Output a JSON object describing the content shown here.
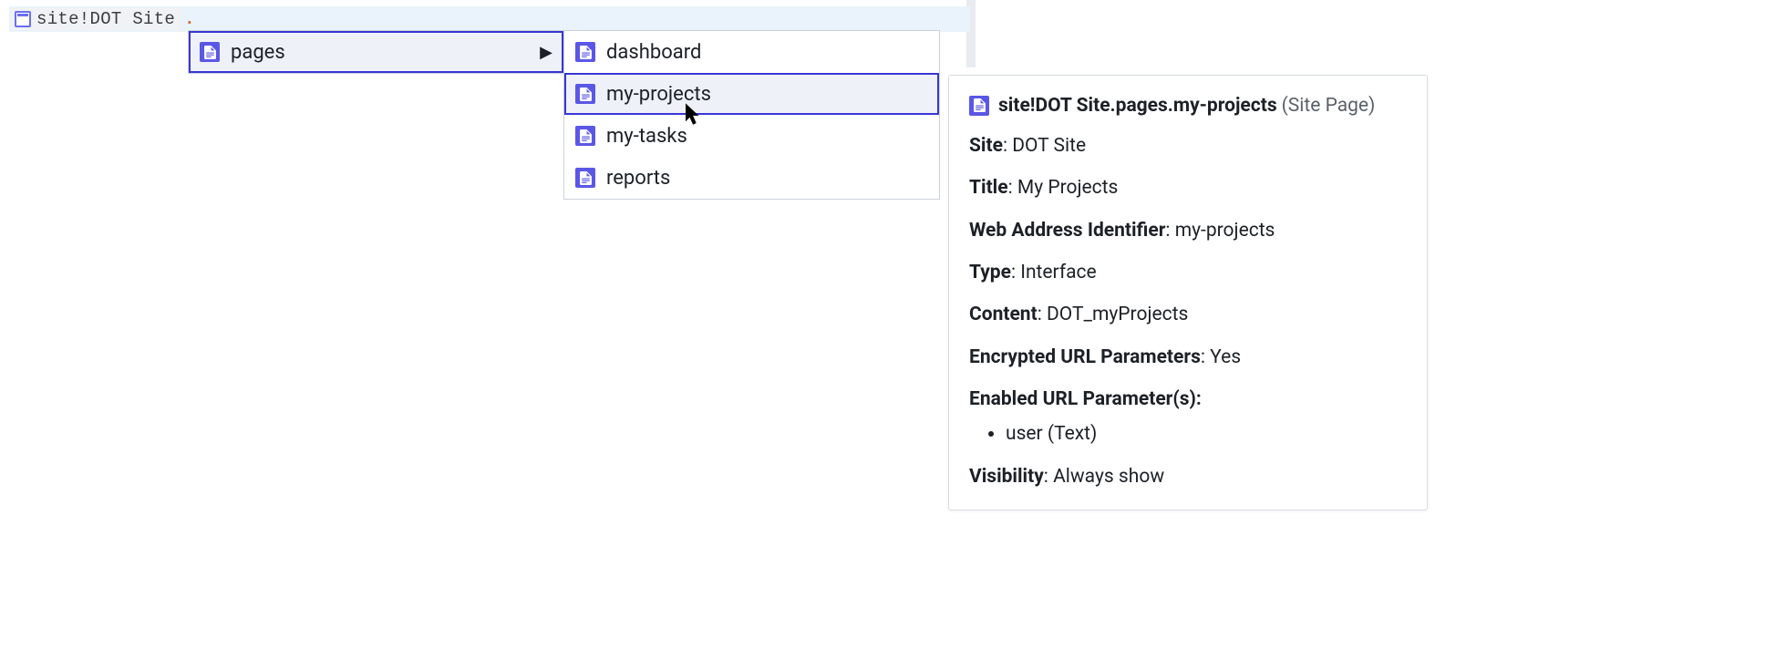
{
  "expr": {
    "chip_text": "site!DOT Site",
    "dot": "."
  },
  "dd1": {
    "items": [
      {
        "label": "pages",
        "has_children": true,
        "selected": true
      }
    ]
  },
  "dd2": {
    "items": [
      {
        "label": "dashboard",
        "selected": false
      },
      {
        "label": "my-projects",
        "selected": true
      },
      {
        "label": "my-tasks",
        "selected": false
      },
      {
        "label": "reports",
        "selected": false
      }
    ]
  },
  "detail": {
    "header_title": "site!DOT Site.pages.my-projects",
    "header_type": "(Site Page)",
    "fields": {
      "site_label": "Site",
      "site_value": "DOT Site",
      "title_label": "Title",
      "title_value": "My Projects",
      "wai_label": "Web Address Identifier",
      "wai_value": "my-projects",
      "type_label": "Type",
      "type_value": "Interface",
      "content_label": "Content",
      "content_value": "DOT_myProjects",
      "encrypted_label": "Encrypted URL Parameters",
      "encrypted_value": "Yes",
      "enabled_params_label": "Enabled URL Parameter(s):",
      "enabled_params": [
        "user (Text)"
      ],
      "visibility_label": "Visibility",
      "visibility_value": "Always show"
    }
  }
}
